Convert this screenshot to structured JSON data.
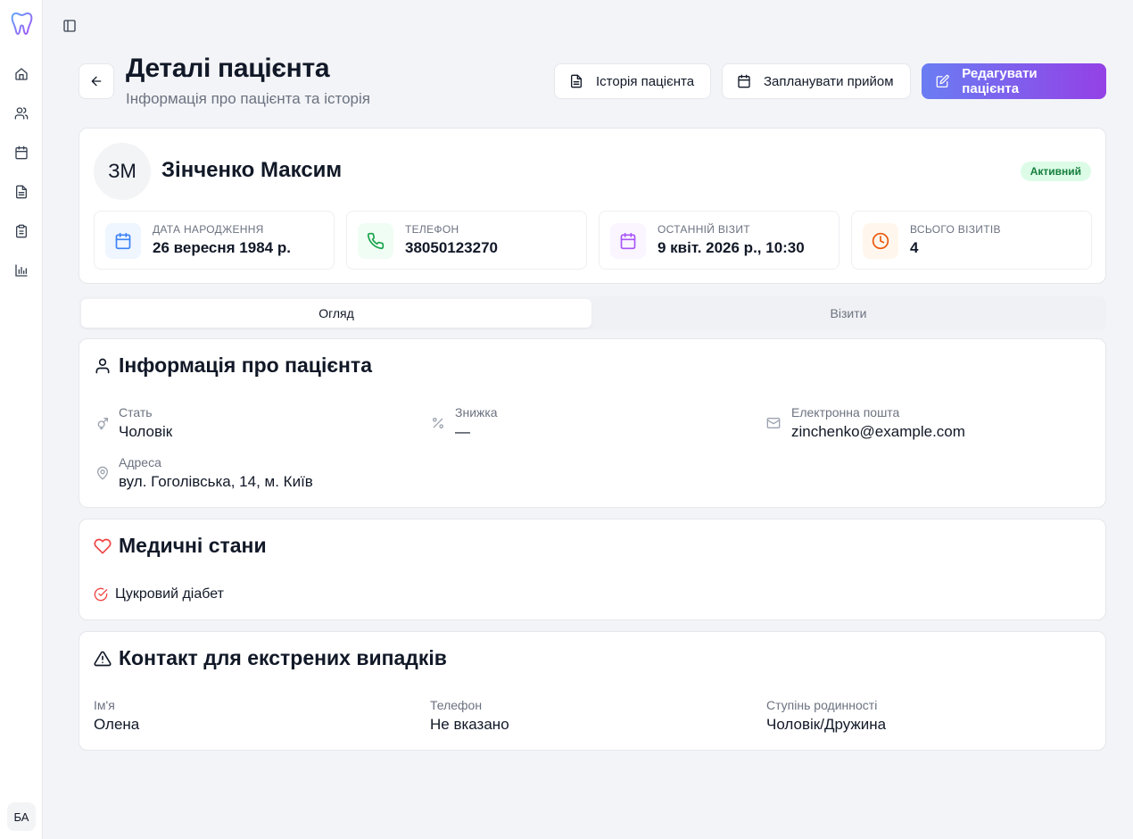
{
  "sidebar": {
    "items": [
      {
        "icon": "home-icon"
      },
      {
        "icon": "users-icon"
      },
      {
        "icon": "calendar-icon"
      },
      {
        "icon": "document-icon"
      },
      {
        "icon": "clipboard-icon"
      },
      {
        "icon": "bar-chart-icon"
      }
    ],
    "user_initials": "БА"
  },
  "header": {
    "title": "Деталі пацієнта",
    "subtitle": "Інформація про пацієнта та історія",
    "history_button": "Історія пацієнта",
    "schedule_button": "Запланувати прийом",
    "edit_button": "Редагувати пацієнта"
  },
  "patient": {
    "initials": "ЗМ",
    "name": "Зінченко Максим",
    "status": "Активний",
    "stats": [
      {
        "label": "ДАТА НАРОДЖЕННЯ",
        "value": "26 вересня 1984 р.",
        "icon": "calendar-icon",
        "color": "#3b82f6",
        "bg": "#eff6ff"
      },
      {
        "label": "ТЕЛЕФОН",
        "value": "38050123270",
        "icon": "phone-icon",
        "color": "#16a34a",
        "bg": "#f0fdf4"
      },
      {
        "label": "ОСТАННІЙ ВІЗИТ",
        "value": "9 квіт. 2026 р., 10:30",
        "icon": "calendar-icon",
        "color": "#a855f7",
        "bg": "#faf5ff"
      },
      {
        "label": "ВСЬОГО ВІЗИТІВ",
        "value": "4",
        "icon": "clock-icon",
        "color": "#ea580c",
        "bg": "#fff7ed"
      }
    ]
  },
  "tabs": {
    "overview": "Огляд",
    "visits": "Візити"
  },
  "info": {
    "title": "Інформація про пацієнта",
    "gender_label": "Стать",
    "gender_value": "Чоловік",
    "discount_label": "Знижка",
    "discount_value": "—",
    "email_label": "Електронна пошта",
    "email_value": "zinchenko@example.com",
    "address_label": "Адреса",
    "address_value": "вул. Гоголівська, 14, м. Київ"
  },
  "medical": {
    "title": "Медичні стани",
    "conditions": [
      "Цукровий діабет"
    ]
  },
  "emergency": {
    "title": "Контакт для екстрених випадків",
    "name_label": "Ім'я",
    "name_value": "Олена",
    "phone_label": "Телефон",
    "phone_value": "Не вказано",
    "relation_label": "Ступінь родинності",
    "relation_value": "Чоловік/Дружина"
  },
  "colors": {
    "accent_start": "#6a7df3",
    "accent_end": "#9441e6",
    "status_green": "#15803d",
    "heart_red": "#ef4444"
  }
}
